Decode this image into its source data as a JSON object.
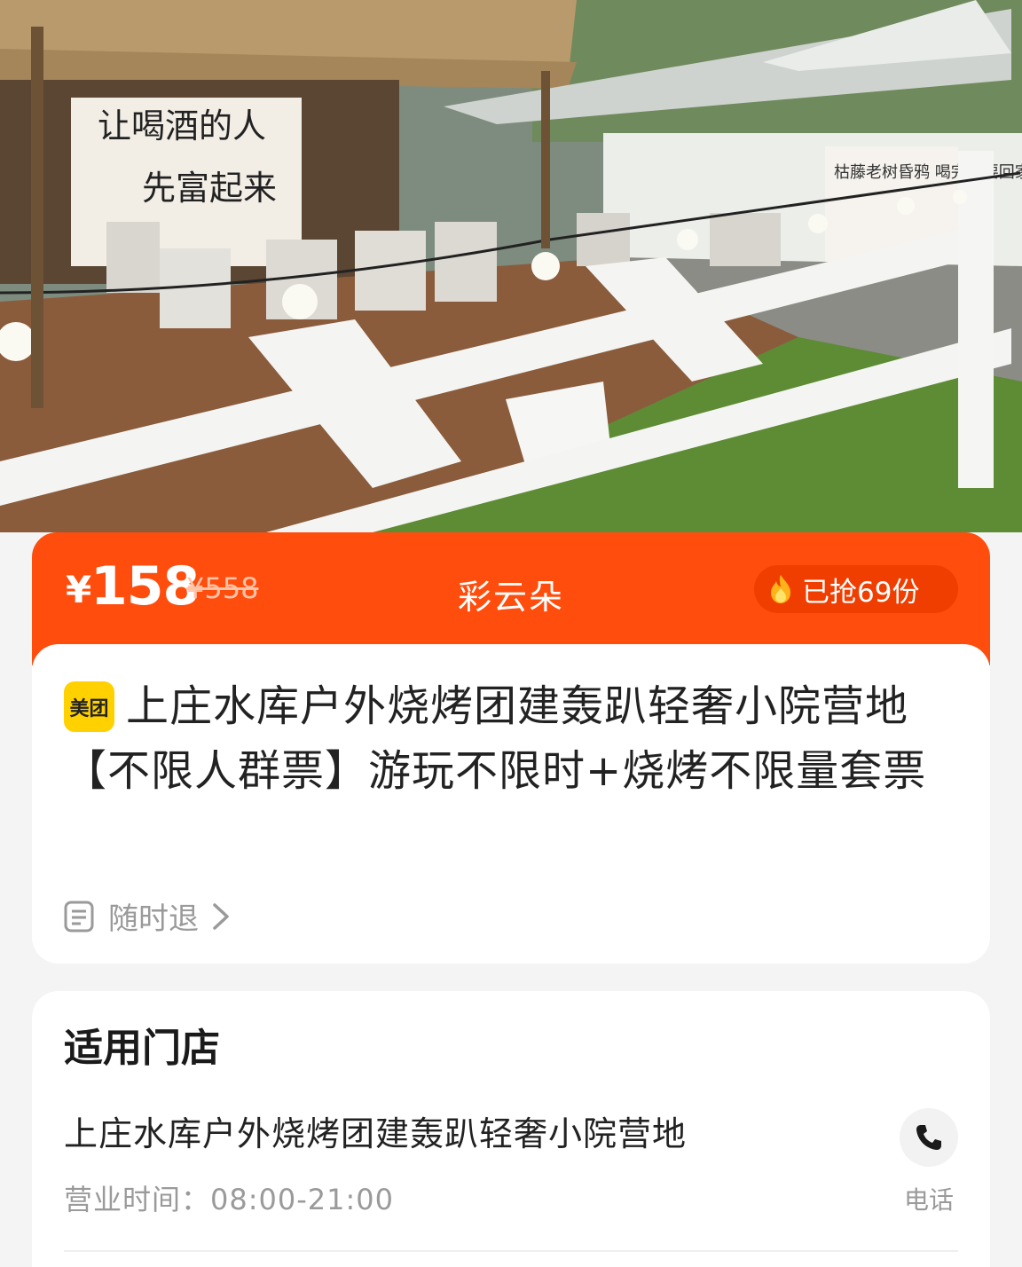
{
  "hero": {
    "image_alt": "outdoor yard with deck chairs, tables, string lights and white fence",
    "banner_text_left": [
      "让喝酒的人",
      "先富起来"
    ],
    "banner_text_right": "枯藤老树昏鸦 喝完就要回家"
  },
  "price_banner": {
    "currency": "¥",
    "price": "158",
    "original_price": "¥558",
    "shop_name": "彩云朵",
    "sold_text": "已抢69份",
    "colors": {
      "banner": "#ff4d0d",
      "pill": "#f03e00"
    }
  },
  "product": {
    "brand_badge": "美团",
    "title": "上庄水库户外烧烤团建轰趴轻奢小院营地【不限人群票】游玩不限时+烧烤不限量套票",
    "refund_label": "随时退"
  },
  "store_section": {
    "title": "适用门店",
    "store_name": "上庄水库户外烧烤团建轰趴轻奢小院营地",
    "hours": "营业时间：08:00-21:00",
    "phone_label": "电话"
  },
  "icons": {
    "fire": "fire-icon",
    "document": "document-icon",
    "chevron": "chevron-right-icon",
    "phone": "phone-icon"
  }
}
